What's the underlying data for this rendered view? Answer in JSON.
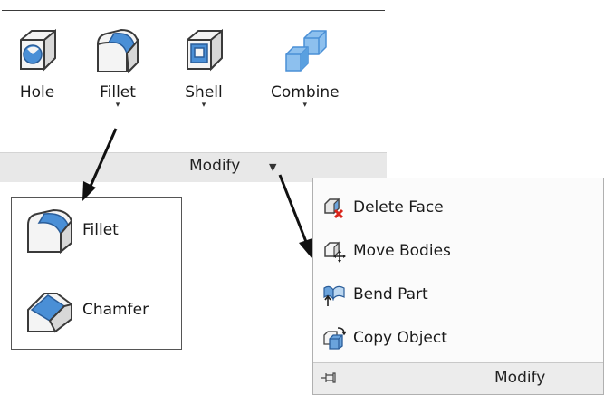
{
  "ribbon": {
    "tools": [
      {
        "id": "hole",
        "label": "Hole",
        "has_menu": false
      },
      {
        "id": "fillet",
        "label": "Fillet",
        "has_menu": true
      },
      {
        "id": "shell",
        "label": "Shell",
        "has_menu": true
      },
      {
        "id": "combine",
        "label": "Combine",
        "has_menu": true
      }
    ],
    "panel_title": "Modify",
    "panel_dropdown_glyph": "▼",
    "tool_caret_glyph": "▾"
  },
  "fillet_flyout": {
    "items": [
      {
        "label": "Fillet",
        "icon": "fillet-icon"
      },
      {
        "label": "Chamfer",
        "icon": "chamfer-icon"
      }
    ]
  },
  "modify_flyout": {
    "items": [
      {
        "label": "Delete Face",
        "icon": "delete-face-icon"
      },
      {
        "label": "Move Bodies",
        "icon": "move-bodies-icon"
      },
      {
        "label": "Bend Part",
        "icon": "bend-part-icon"
      },
      {
        "label": "Copy Object",
        "icon": "copy-object-icon"
      }
    ],
    "footer_title": "Modify",
    "footer_icon": "pin-icon"
  },
  "colors": {
    "icon_blue": "#4a8fd6",
    "icon_outline": "#3a3a3a",
    "delete_red": "#d9261c",
    "panel_bar": "#e8e8e8"
  }
}
